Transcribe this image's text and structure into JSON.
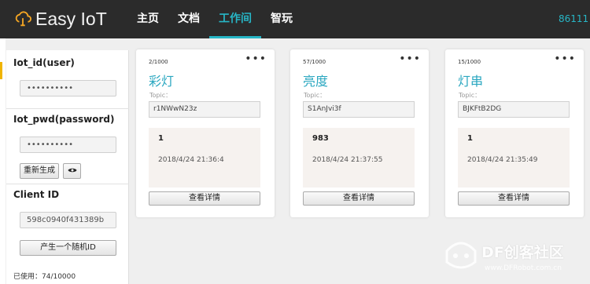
{
  "app": {
    "title": "Easy IoT",
    "account": "86111"
  },
  "nav": [
    {
      "label": "主页",
      "active": false
    },
    {
      "label": "文档",
      "active": false
    },
    {
      "label": "工作间",
      "active": true
    },
    {
      "label": "智玩",
      "active": false
    }
  ],
  "sidebar": {
    "iot_id_label": "Iot_id(user)",
    "iot_id_value": "••••••••••",
    "iot_pwd_label": "Iot_pwd(password)",
    "iot_pwd_value": "••••••••••",
    "regenerate_label": "重新生成",
    "client_id_label": "Client ID",
    "client_id_value": "598c0940f431389b",
    "random_id_label": "产生一个随机ID",
    "usage": "已使用：74/10000"
  },
  "cards": [
    {
      "count": "2/1000",
      "name": "彩灯",
      "topic_label": "Topic：",
      "topic": "r1NWwN23z",
      "value": "1",
      "time": "2018/4/24 21:36:4",
      "detail_label": "查看详情"
    },
    {
      "count": "57/1000",
      "name": "亮度",
      "topic_label": "Topic：",
      "topic": "S1AnJvi3f",
      "value": "983",
      "time": "2018/4/24 21:37:55",
      "detail_label": "查看详情"
    },
    {
      "count": "15/1000",
      "name": "灯串",
      "topic_label": "Topic：",
      "topic": "BJKFtB2DG",
      "value": "1",
      "time": "2018/4/24 21:35:49",
      "detail_label": "查看详情"
    }
  ],
  "watermark": {
    "text": "DF创客社区",
    "url": "www.DFRobot.com.cn"
  },
  "colors": {
    "accent": "#27b6c6",
    "topbar": "#2b2b2b",
    "card_name": "#2aa7c0"
  },
  "icons": {
    "logo": "cloud-bulb-icon",
    "eye": "eye-icon",
    "more": "more-dots-icon"
  }
}
